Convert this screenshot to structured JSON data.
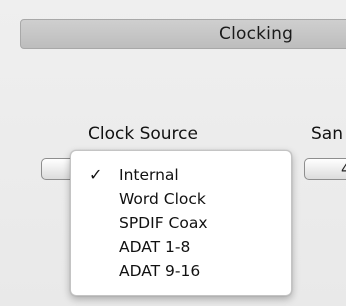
{
  "section": {
    "title": "Clocking"
  },
  "clock_source": {
    "label": "Clock Source",
    "menu": {
      "items": [
        {
          "label": "Internal",
          "checked": true,
          "check_glyph": "✓"
        },
        {
          "label": "Word Clock",
          "checked": false,
          "check_glyph": ""
        },
        {
          "label": "SPDIF Coax",
          "checked": false,
          "check_glyph": ""
        },
        {
          "label": "ADAT 1-8",
          "checked": false,
          "check_glyph": ""
        },
        {
          "label": "ADAT 9-16",
          "checked": false,
          "check_glyph": ""
        }
      ]
    }
  },
  "sample_rate": {
    "label": "San",
    "value": "4"
  }
}
